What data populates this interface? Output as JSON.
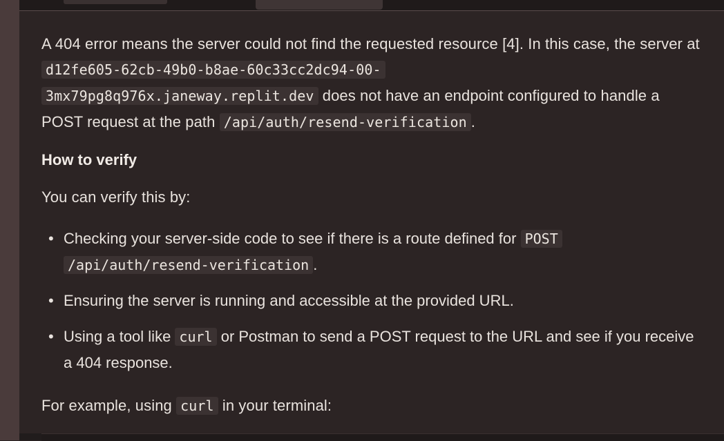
{
  "explanation": {
    "p1_a": "A 404 error means the server could not find the requested resource [4]. In this case, the server at ",
    "p1_url_line1": "d12fe605-62cb-49b0-b8ae-60c33cc2dc94-00-",
    "p1_url_line2": "3mx79pg8q976x.janeway.replit.dev",
    "p1_b": " does not have an endpoint configured to handle a POST request at the path ",
    "p1_path": "/api/auth/resend-verification",
    "p1_c": "."
  },
  "heading": "How to verify",
  "p2": "You can verify this by:",
  "bullets": [
    {
      "text_a": "Checking your server-side code to see if there is a route defined for ",
      "code_1": "POST",
      "code_2": "/api/auth/resend-verification",
      "text_b": "."
    },
    {
      "text_a": "Ensuring the server is running and accessible at the provided URL."
    },
    {
      "text_a": "Using a tool like ",
      "code_1": "curl",
      "text_b": " or Postman to send a POST request to the URL and see if you receive a 404 response."
    }
  ],
  "p3": {
    "text_a": "For example, using ",
    "code": "curl",
    "text_b": " in your terminal:"
  },
  "bullet_symbol": "•"
}
